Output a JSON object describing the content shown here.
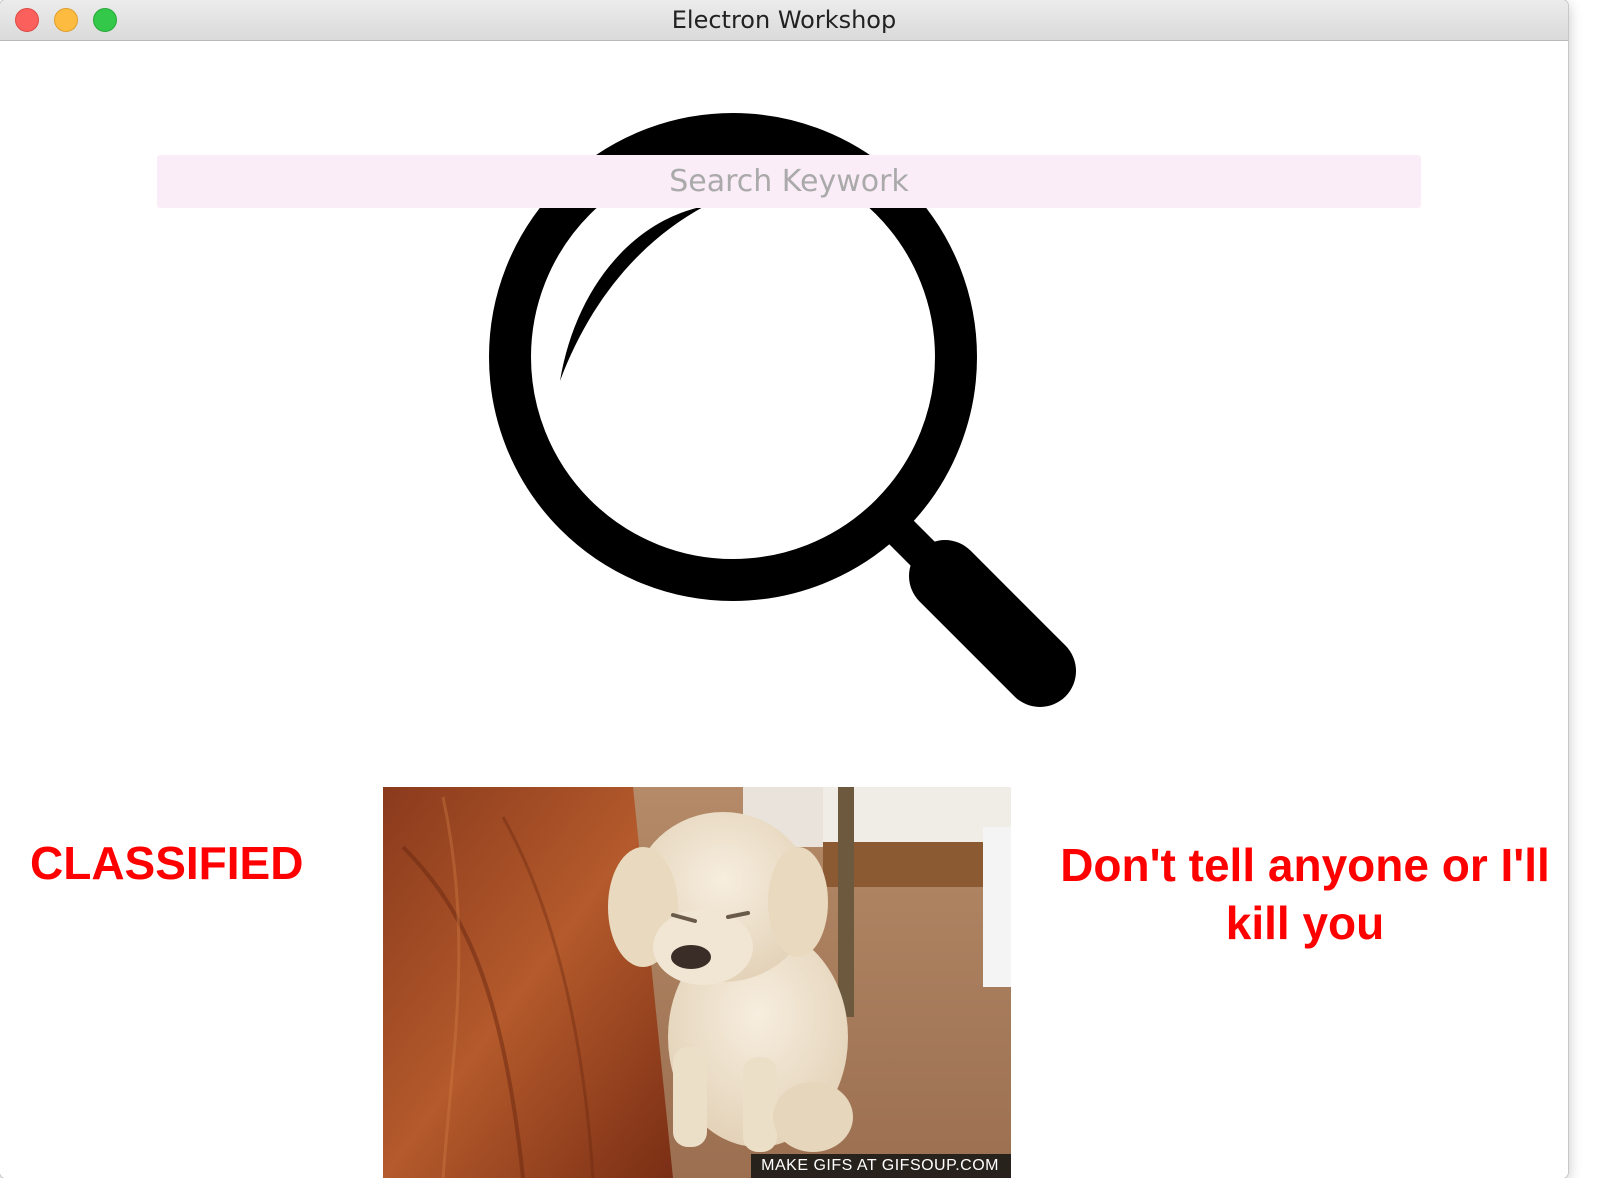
{
  "window": {
    "title": "Electron Workshop"
  },
  "search": {
    "placeholder": "Search Keywork",
    "value": ""
  },
  "left_text": "CLASSIFIED",
  "right_text": "Don't tell anyone or I'll kill you",
  "gif": {
    "caption": "MAKE GIFS AT GIFSOUP.COM"
  },
  "icons": {
    "center": "magnifying-glass-icon"
  },
  "colors": {
    "alert_text": "#ff0000",
    "search_bg": "#fbedf8",
    "icon": "#000000"
  }
}
